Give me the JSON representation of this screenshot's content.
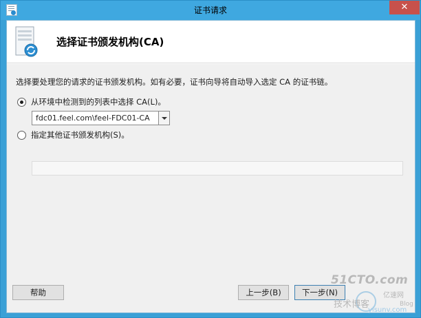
{
  "window": {
    "title": "证书请求",
    "close_glyph": "✕"
  },
  "header": {
    "title": "选择证书颁发机构(CA)",
    "icon": "certificate-server-icon"
  },
  "body": {
    "instruction": "选择要处理您的请求的证书颁发机构。如有必要，证书向导将自动导入选定 CA 的证书链。",
    "options": [
      {
        "label": "从环境中检测到的列表中选择 CA(L)。",
        "checked": true
      },
      {
        "label": "指定其他证书颁发机构(S)。",
        "checked": false
      }
    ],
    "ca_select": {
      "value": "fdc01.feel.com\\feel-FDC01-CA"
    },
    "ca_input": {
      "value": ""
    }
  },
  "buttons": {
    "help": "帮助",
    "prev": "上一步(B)",
    "next": "下一步(N)"
  },
  "watermark": {
    "main": "51CTO.com",
    "sub": "技术博客",
    "sub2": "亿速网",
    "sub3": "yisunv.com",
    "sub4": "Blog"
  },
  "colors": {
    "titlebar": "#3fa8e0",
    "close": "#c7514b",
    "body_bg": "#f0f0f0"
  }
}
